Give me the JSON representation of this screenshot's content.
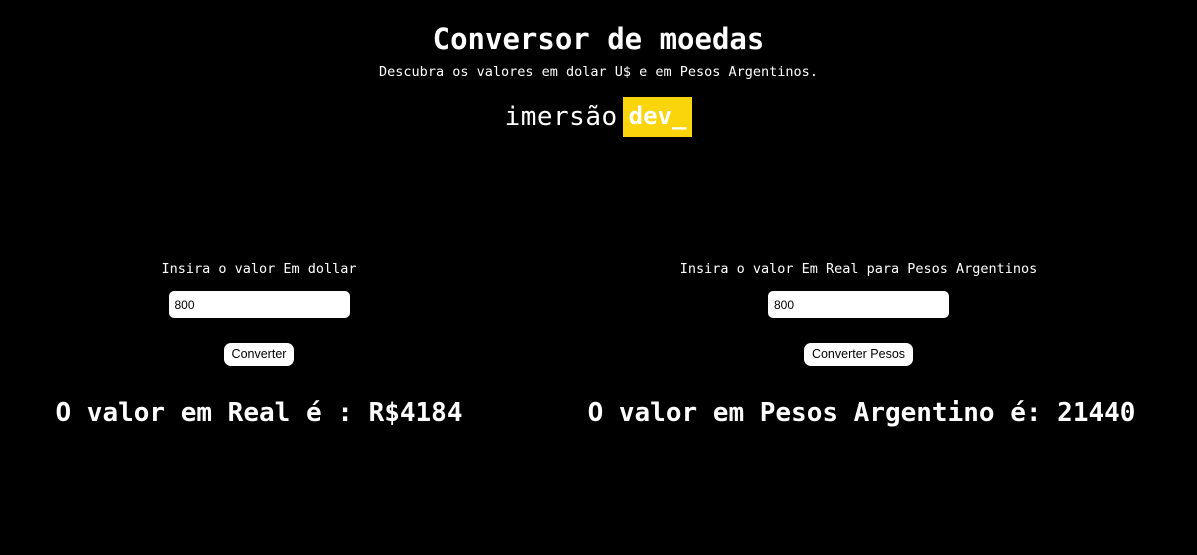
{
  "header": {
    "title": "Conversor de moedas",
    "subtitle": "Descubra os valores em dolar U$ e em Pesos Argentinos."
  },
  "logo": {
    "text_main": "imersão",
    "text_badge": "dev_",
    "badge_color": "#fbd50c"
  },
  "dollar_converter": {
    "label": "Insira o valor Em dollar",
    "input_value": "800",
    "button_label": "Converter",
    "result_text": "O valor em Real é : R$4184"
  },
  "peso_converter": {
    "label": "Insira o valor Em Real para Pesos Argentinos",
    "input_value": "800",
    "button_label": "Converter Pesos",
    "result_text": "O valor em Pesos Argentino é: 21440"
  },
  "colors": {
    "background": "#000000",
    "text": "#ffffff",
    "accent": "#fbd50c"
  }
}
